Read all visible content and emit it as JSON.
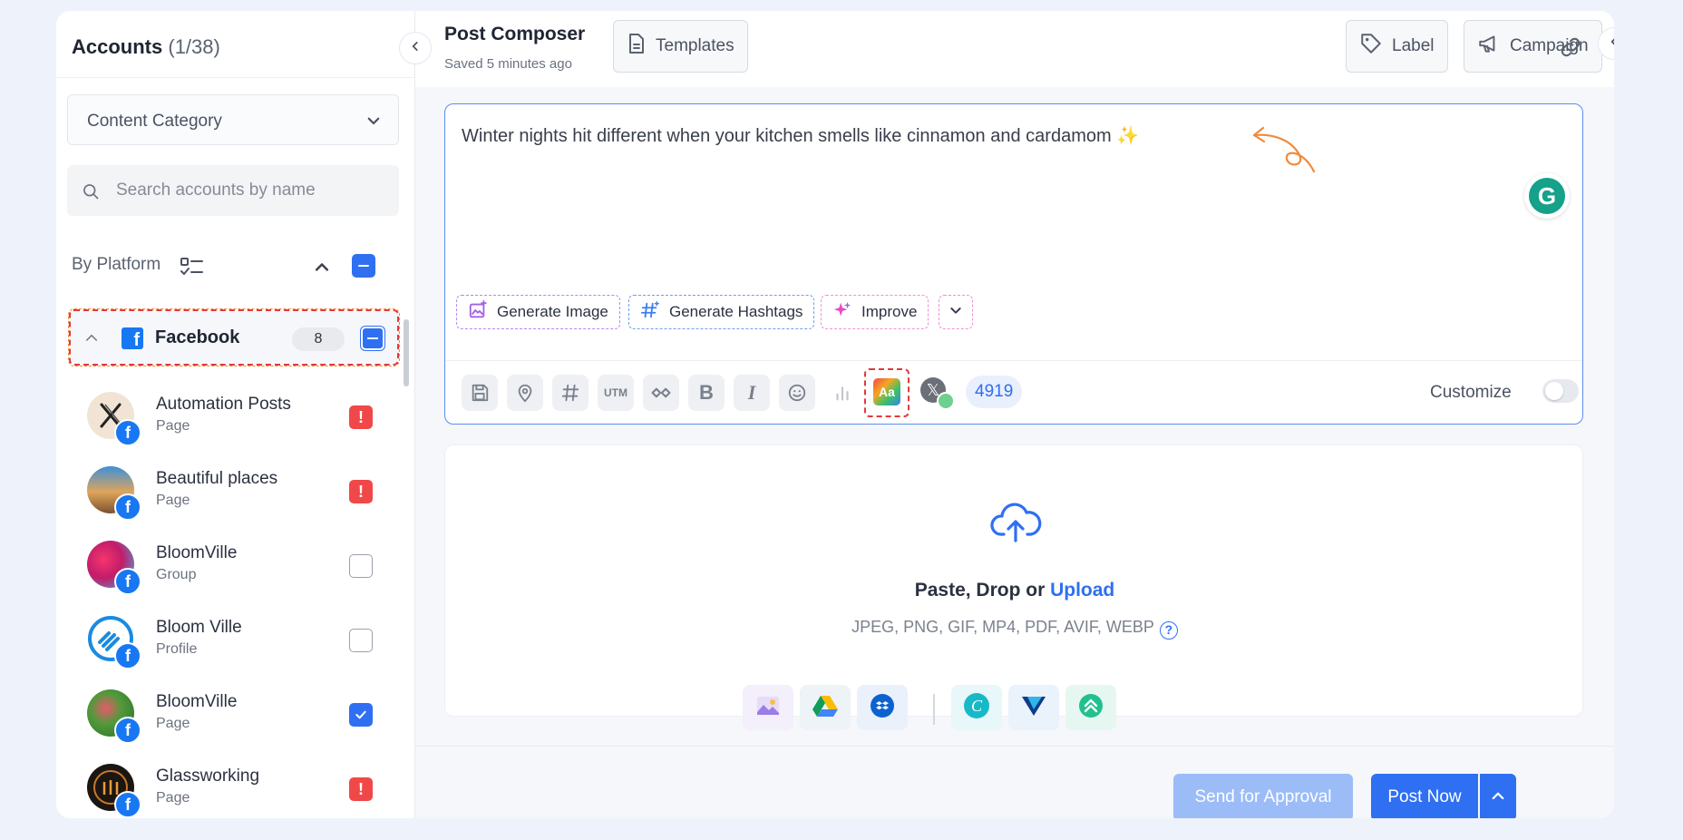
{
  "sidebar": {
    "title": "Accounts",
    "count": "(1/38)",
    "category_label": "Content Category",
    "search_placeholder": "Search accounts by name",
    "by_platform_label": "By Platform",
    "platform": {
      "name": "Facebook",
      "count": "8"
    },
    "accounts": [
      {
        "name": "Automation Posts",
        "type": "Page",
        "status": "warning"
      },
      {
        "name": "Beautiful places",
        "type": "Page",
        "status": "warning"
      },
      {
        "name": "BloomVille",
        "type": "Group",
        "status": "unchecked"
      },
      {
        "name": "Bloom Ville",
        "type": "Profile",
        "status": "unchecked"
      },
      {
        "name": "BloomVille",
        "type": "Page",
        "status": "checked"
      },
      {
        "name": "Glassworking",
        "type": "Page",
        "status": "warning"
      }
    ]
  },
  "header": {
    "title": "Post Composer",
    "saved": "Saved 5 minutes ago",
    "templates_label": "Templates",
    "label_label": "Label",
    "campaign_label": "Campaign"
  },
  "editor": {
    "text": "Winter nights hit different when your kitchen smells like cinnamon and cardamom ✨",
    "ai": {
      "generate_image": "Generate Image",
      "generate_hashtags": "Generate Hashtags",
      "improve": "Improve"
    },
    "toolbar": {
      "utm_label": "UTM",
      "bold_label": "B",
      "italic_label": "I",
      "aa_label": "Aa",
      "x_label": "𝕏",
      "char_count": "4919",
      "customize_label": "Customize"
    }
  },
  "upload": {
    "title_prefix": "Paste, Drop or ",
    "title_link": "Upload",
    "formats": "JPEG, PNG, GIF, MP4, PDF, AVIF, WEBP",
    "help": "?"
  },
  "footer": {
    "send_for_approval": "Send for Approval",
    "post_now": "Post Now"
  },
  "colors": {
    "accent": "#2f6ff2",
    "warning": "#f04848",
    "facebook": "#1877f2"
  }
}
